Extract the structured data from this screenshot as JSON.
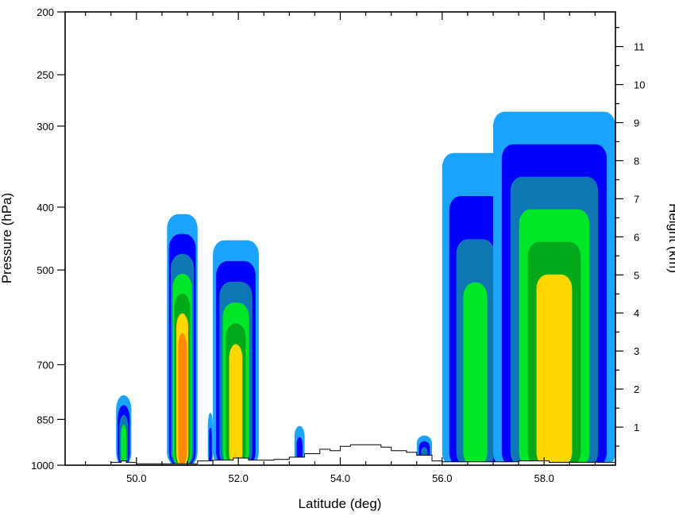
{
  "chart_data": {
    "type": "contour",
    "xlabel": "Latitude (deg)",
    "ylabel": "Pressure (hPa)",
    "y2label": "Height (km)",
    "xlim": [
      48.6,
      59.4
    ],
    "xticks": [
      50.0,
      52.0,
      54.0,
      56.0,
      58.0
    ],
    "xtick_labels": [
      "50.0",
      "52.0",
      "54.0",
      "56.0",
      "58.0"
    ],
    "ylim_pressure": [
      1000,
      200
    ],
    "yscale": "log",
    "yticks": [
      200,
      250,
      300,
      400,
      500,
      700,
      850,
      1000
    ],
    "ytick_labels": [
      "200",
      "250",
      "300",
      "400",
      "500",
      "700",
      "850",
      "1000"
    ],
    "y2ticks": [
      1,
      2,
      3,
      4,
      5,
      6,
      7,
      8,
      9,
      10,
      11
    ],
    "y2tick_labels": [
      "1",
      "2",
      "3",
      "4",
      "5",
      "6",
      "7",
      "8",
      "9",
      "10",
      "11"
    ],
    "contour_levels": [
      {
        "level": 1,
        "color": "#1aa3ff"
      },
      {
        "level": 2,
        "color": "#0000ff"
      },
      {
        "level": 3,
        "color": "#0f78b4"
      },
      {
        "level": 4,
        "color": "#00e629"
      },
      {
        "level": 5,
        "color": "#00a919"
      },
      {
        "level": 6,
        "color": "#ffd700"
      },
      {
        "level": 7,
        "color": "#ff8c00"
      }
    ],
    "cells": [
      {
        "lat_min": 49.6,
        "lat_max": 49.9,
        "p_top": 780,
        "peak_level": 4
      },
      {
        "lat_min": 50.6,
        "lat_max": 51.2,
        "p_top": 410,
        "peak_level": 7
      },
      {
        "lat_min": 51.4,
        "lat_max": 51.5,
        "p_top": 830,
        "peak_level": 2
      },
      {
        "lat_min": 51.5,
        "lat_max": 52.4,
        "p_top": 450,
        "peak_level": 6
      },
      {
        "lat_min": 53.1,
        "lat_max": 53.3,
        "p_top": 870,
        "peak_level": 2
      },
      {
        "lat_min": 55.5,
        "lat_max": 55.8,
        "p_top": 900,
        "peak_level": 3
      },
      {
        "lat_min": 56.0,
        "lat_max": 57.3,
        "p_top": 330,
        "peak_level": 4
      },
      {
        "lat_min": 57.0,
        "lat_max": 59.4,
        "p_top": 285,
        "peak_level": 6
      }
    ],
    "terrain_max_pressure": 920
  }
}
